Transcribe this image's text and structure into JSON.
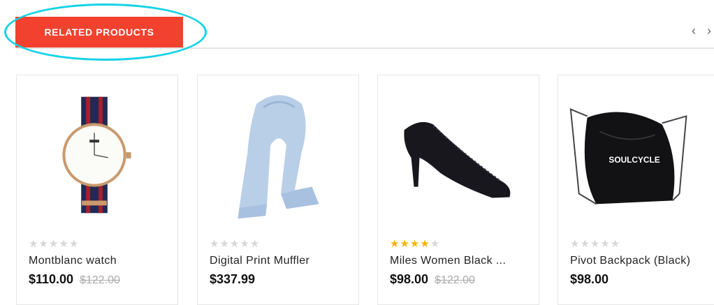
{
  "section": {
    "title": "RELATED PRODUCTS",
    "nav_prev": "‹",
    "nav_next": "›"
  },
  "colors": {
    "accent": "#f2412e",
    "highlight": "#14d2e6",
    "star_on": "#f5b400",
    "star_off": "#d7d7d7"
  },
  "products": [
    {
      "name": "Montblanc watch",
      "price": "$110.00",
      "old_price": "$122.00",
      "rating": 0,
      "stars": "★★★★★",
      "image_icon": "wristwatch-icon"
    },
    {
      "name": "Digital Print Muffler",
      "price": "$337.99",
      "old_price": "",
      "rating": 0,
      "stars": "★★★★★",
      "image_icon": "scarf-icon"
    },
    {
      "name": "Miles Women Black ...",
      "price": "$98.00",
      "old_price": "$122.00",
      "rating": 4,
      "stars": "★★★★★",
      "image_icon": "high-heel-shoe-icon"
    },
    {
      "name": "Pivot Backpack (Black)",
      "price": "$98.00",
      "old_price": "",
      "rating": 0,
      "stars": "★★★★★",
      "image_icon": "drawstring-backpack-icon"
    }
  ]
}
